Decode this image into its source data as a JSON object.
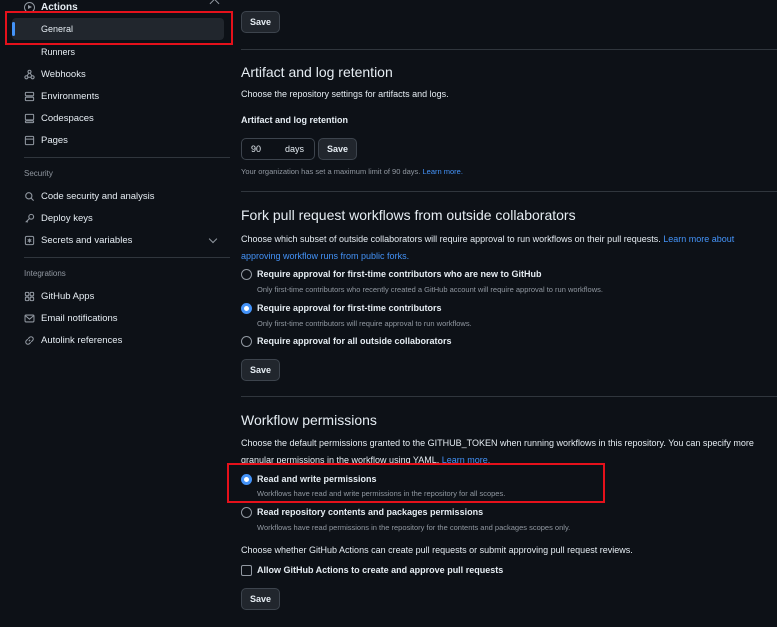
{
  "sidebar": {
    "actions_label": "Actions",
    "general_label": "General",
    "runners_label": "Runners",
    "items": [
      {
        "label": "Webhooks",
        "icon": "webhook-icon"
      },
      {
        "label": "Environments",
        "icon": "server-icon"
      },
      {
        "label": "Codespaces",
        "icon": "codespaces-icon"
      },
      {
        "label": "Pages",
        "icon": "browser-icon"
      }
    ],
    "security_heading": "Security",
    "security_items": [
      {
        "label": "Code security and analysis",
        "icon": "codescan-icon"
      },
      {
        "label": "Deploy keys",
        "icon": "key-icon"
      },
      {
        "label": "Secrets and variables",
        "icon": "asterisk-icon"
      }
    ],
    "integrations_heading": "Integrations",
    "integration_items": [
      {
        "label": "GitHub Apps",
        "icon": "apps-icon"
      },
      {
        "label": "Email notifications",
        "icon": "mail-icon"
      },
      {
        "label": "Autolink references",
        "icon": "link-icon"
      }
    ]
  },
  "main": {
    "save_label": "Save",
    "artifact": {
      "title": "Artifact and log retention",
      "description": "Choose the repository settings for artifacts and logs.",
      "field_label": "Artifact and log retention",
      "days_value": "90",
      "days_unit": "days",
      "note": "Your organization has set a maximum limit of 90 days.",
      "learn_more": "Learn more."
    },
    "fork": {
      "title": "Fork pull request workflows from outside collaborators",
      "description": "Choose which subset of outside collaborators will require approval to run workflows on their pull requests.",
      "learn_more": "Learn more about approving workflow runs from public forks.",
      "options": [
        {
          "label": "Require approval for first-time contributors who are new to GitHub",
          "hint": "Only first-time contributors who recently created a GitHub account will require approval to run workflows.",
          "selected": false
        },
        {
          "label": "Require approval for first-time contributors",
          "hint": "Only first-time contributors will require approval to run workflows.",
          "selected": true
        },
        {
          "label": "Require approval for all outside collaborators",
          "hint": "",
          "selected": false
        }
      ]
    },
    "workflow": {
      "title": "Workflow permissions",
      "description": "Choose the default permissions granted to the GITHUB_TOKEN when running workflows in this repository. You can specify more granular permissions in the workflow using YAML.",
      "learn_more": "Learn more.",
      "options": [
        {
          "label": "Read and write permissions",
          "hint": "Workflows have read and write permissions in the repository for all scopes.",
          "selected": true
        },
        {
          "label": "Read repository contents and packages permissions",
          "hint": "Workflows have read permissions in the repository for the contents and packages scopes only.",
          "selected": false
        }
      ],
      "pr_question": "Choose whether GitHub Actions can create pull requests or submit approving pull request reviews.",
      "checkbox_label": "Allow GitHub Actions to create and approve pull requests",
      "checkbox_checked": false
    }
  },
  "colors": {
    "background": "#0d1117",
    "accent": "#4493f8",
    "highlight": "#e5111b"
  }
}
